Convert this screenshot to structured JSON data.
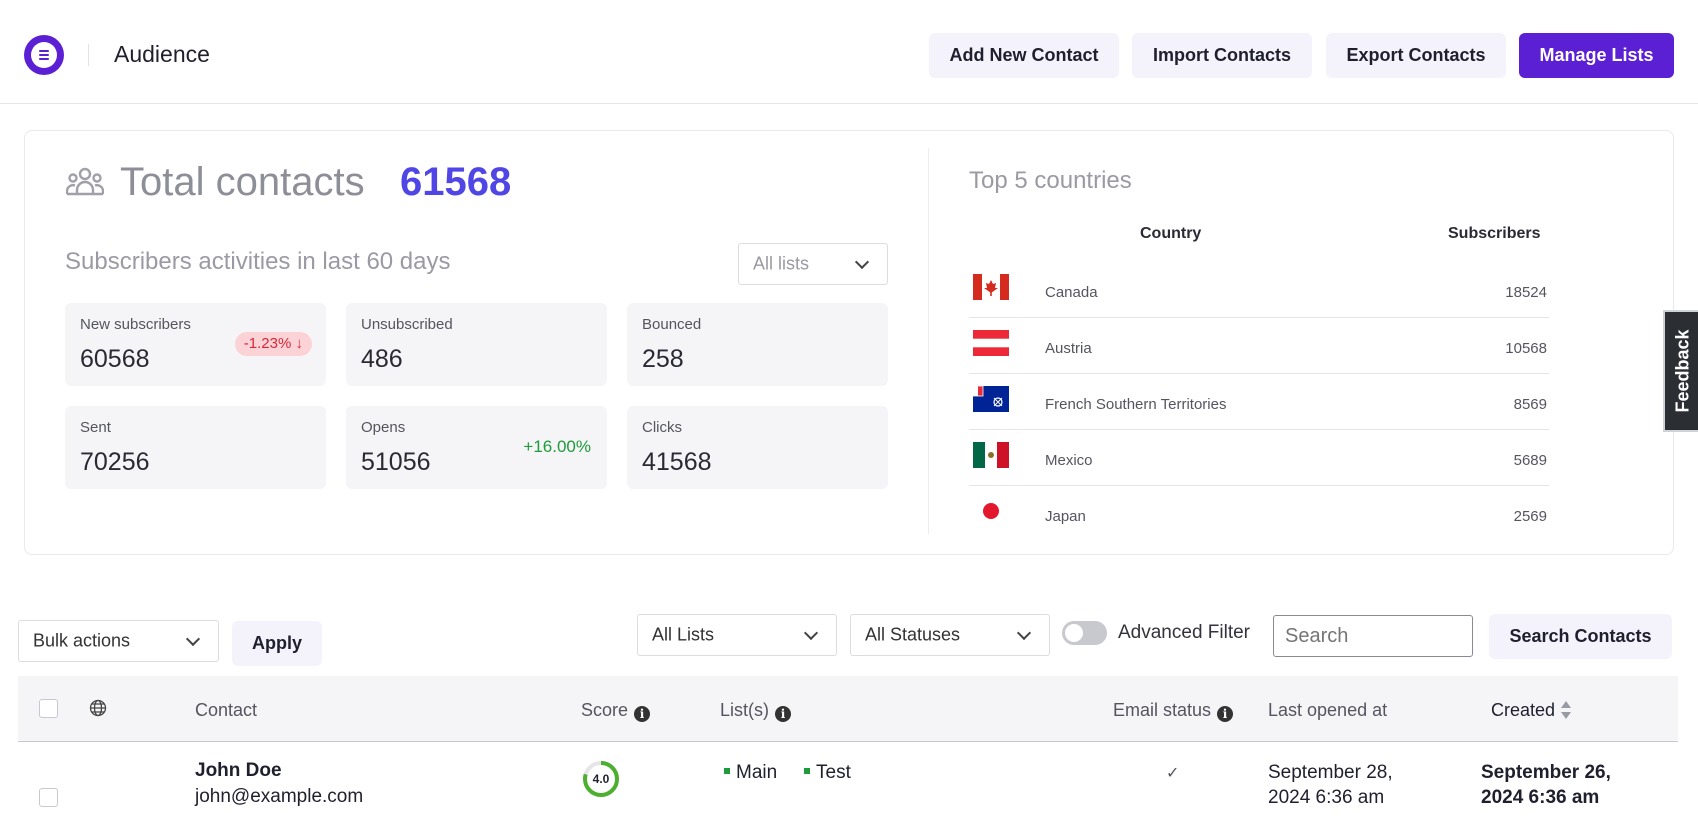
{
  "header": {
    "title": "Audience",
    "buttons": {
      "add_new": "Add New Contact",
      "import": "Import Contacts",
      "export": "Export Contacts",
      "manage_lists": "Manage Lists"
    },
    "brand_color": "#5b1fd4"
  },
  "summary": {
    "total_label": "Total contacts",
    "total_value": "61568",
    "activities_title": "Subscribers activities in last 60 days",
    "list_filter": "All lists",
    "stats": [
      {
        "label": "New subscribers",
        "value": "60568",
        "badge": "-1.23%",
        "badge_type": "negative"
      },
      {
        "label": "Unsubscribed",
        "value": "486"
      },
      {
        "label": "Bounced",
        "value": "258"
      },
      {
        "label": "Sent",
        "value": "70256"
      },
      {
        "label": "Opens",
        "value": "51056",
        "badge": "+16.00%",
        "badge_type": "positive"
      },
      {
        "label": "Clicks",
        "value": "41568"
      }
    ]
  },
  "countries": {
    "title": "Top 5 countries",
    "col_country": "Country",
    "col_subscribers": "Subscribers",
    "rows": [
      {
        "name": "Canada",
        "subscribers": "18524",
        "flag": "canada-flag"
      },
      {
        "name": "Austria",
        "subscribers": "10568",
        "flag": "austria-flag"
      },
      {
        "name": "French Southern Territories",
        "subscribers": "8569",
        "flag": "french-southern-territories-flag"
      },
      {
        "name": "Mexico",
        "subscribers": "5689",
        "flag": "mexico-flag"
      },
      {
        "name": "Japan",
        "subscribers": "2569",
        "flag": "japan-flag"
      }
    ]
  },
  "feedback": "Feedback",
  "filters": {
    "bulk_actions": "Bulk actions",
    "apply": "Apply",
    "lists": "All Lists",
    "statuses": "All Statuses",
    "advanced_filter": "Advanced Filter",
    "search_placeholder": "Search",
    "search_button": "Search Contacts"
  },
  "table": {
    "columns": {
      "contact": "Contact",
      "score": "Score",
      "lists": "List(s)",
      "email_status": "Email status",
      "last_opened": "Last opened at",
      "created": "Created"
    },
    "rows": [
      {
        "name": "John Doe",
        "email": "john@example.com",
        "score": "4.0",
        "lists": [
          "Main",
          "Test"
        ],
        "email_status": "✓",
        "last_opened": "September 28, 2024 6:36 am",
        "created": "September 26, 2024 6:36 am"
      }
    ]
  }
}
